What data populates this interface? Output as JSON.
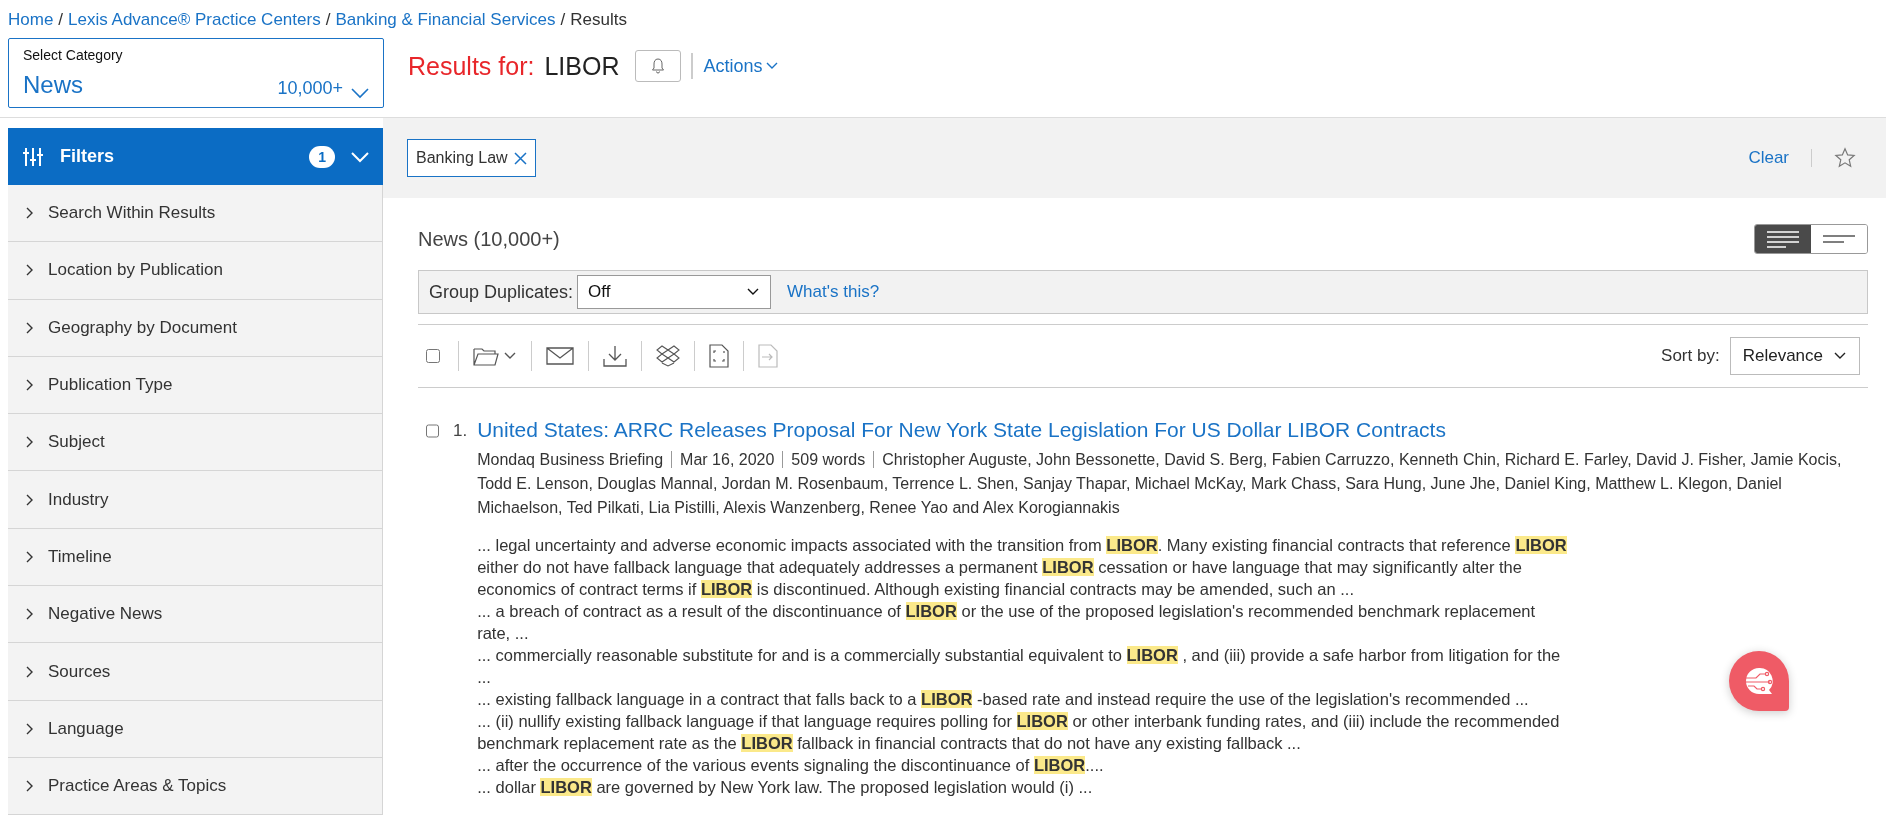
{
  "breadcrumb": [
    {
      "label": "Home",
      "link": true
    },
    {
      "label": "Lexis Advance® Practice Centers",
      "link": true
    },
    {
      "label": "Banking & Financial Services",
      "link": true
    },
    {
      "label": "Results",
      "link": false
    }
  ],
  "breadcrumb_separator": "/",
  "category": {
    "label": "Select Category",
    "value": "News",
    "count": "10,000+"
  },
  "results_header": {
    "prefix": "Results for:",
    "query": "LIBOR",
    "actions": "Actions"
  },
  "filters": {
    "title": "Filters",
    "count": "1",
    "items": [
      {
        "label": "Search Within Results",
        "expanded": false
      },
      {
        "label": "Location by Publication",
        "expanded": false
      },
      {
        "label": "Geography by Document",
        "expanded": false
      },
      {
        "label": "Publication Type",
        "expanded": false
      },
      {
        "label": "Subject",
        "expanded": false
      },
      {
        "label": "Industry",
        "expanded": false
      },
      {
        "label": "Timeline",
        "expanded": false
      },
      {
        "label": "Negative News",
        "expanded": false
      },
      {
        "label": "Sources",
        "expanded": false
      },
      {
        "label": "Language",
        "expanded": false
      },
      {
        "label": "Practice Areas & Topics",
        "expanded": false
      }
    ]
  },
  "applied_filters": [
    "Banking Law"
  ],
  "clear": "Clear",
  "results_title": "News (10,000+)",
  "view_toggle": [
    {
      "selected": true
    },
    {
      "selected": false
    }
  ],
  "group_duplicates": {
    "label": "Group Duplicates:",
    "value": "Off",
    "help": "What's this?"
  },
  "select_all": {
    "checked": false
  },
  "sort": {
    "label": "Sort by:",
    "value": "Relevance"
  },
  "results": [
    {
      "number": "1.",
      "checked": false,
      "title": "United States: ARRC Releases Proposal For New York State Legislation For US Dollar LIBOR Contracts",
      "source": "Mondaq Business Briefing",
      "date": "Mar 16, 2020",
      "words": "509 words",
      "authors": "Christopher Auguste, John Bessonette, David S. Berg, Fabien Carruzzo, Kenneth Chin, Richard E. Farley, David J. Fisher, Jamie Kocis, Todd E. Lenson, Douglas Mannal, Jordan M. Rosenbaum, Terrence L. Shen, Sanjay Thapar, Michael McKay, Mark Chass, Sara Hung, June Jhe, Daniel King, Matthew L. Klegon, Daniel Michaelson, Ted Pilkati, Lia Pistilli, Alexis Wanzenberg, Renee Yao and Alex Korogiannakis",
      "snippets": [
        "... legal uncertainty and adverse economic impacts associated with the transition from **LIBOR**. Many existing financial contracts that reference **LIBOR** either do not have fallback language that adequately addresses a permanent **LIBOR** cessation or have language that may significantly alter the economics of contract terms if **LIBOR** is discontinued. Although existing financial contracts may be amended, such an ...",
        "... a breach of contract as a result of the discontinuance of **LIBOR** or the use of the proposed legislation's recommended benchmark replacement rate, ...",
        "... commercially reasonable substitute for and is a commercially substantial equivalent to **LIBOR** , and (iii) provide a safe harbor from litigation for the ...",
        "... existing fallback language in a contract that falls back to a **LIBOR** -based rate and instead require the use of the legislation's recommended ...",
        "... (ii) nullify existing fallback language if that language requires polling for **LIBOR** or other interbank funding rates, and (iii) include the recommended benchmark replacement rate as the **LIBOR** fallback in financial contracts that do not have any existing fallback ...",
        "... after the occurrence of the various events signaling the discontinuance of **LIBOR**....",
        "... dollar **LIBOR** are governed by New York law. The proposed legislation would (i) ..."
      ]
    }
  ]
}
